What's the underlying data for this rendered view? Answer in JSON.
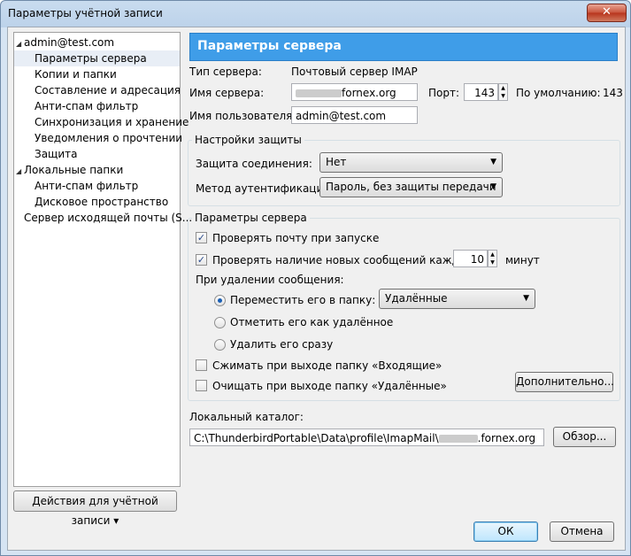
{
  "window": {
    "title": "Параметры учётной записи",
    "close_label": "✕"
  },
  "tree": {
    "items": [
      {
        "label": "admin@test.com",
        "expander": "◢"
      },
      {
        "label": "Параметры сервера"
      },
      {
        "label": "Копии и папки"
      },
      {
        "label": "Составление и адресация"
      },
      {
        "label": "Анти-спам фильтр"
      },
      {
        "label": "Синхронизация и хранение"
      },
      {
        "label": "Уведомления о прочтении"
      },
      {
        "label": "Защита"
      },
      {
        "label": "Локальные папки",
        "expander": "◢"
      },
      {
        "label": "Анти-спам фильтр"
      },
      {
        "label": "Дисковое пространство"
      },
      {
        "label": "Сервер исходящей почты (S..."
      }
    ],
    "actions_label": "Действия для учётной записи",
    "actions_arrow": "▾"
  },
  "banner": {
    "title": "Параметры сервера"
  },
  "server": {
    "type_label": "Тип сервера:",
    "type_value": "Почтовый сервер IMAP",
    "name_label": "Имя сервера:",
    "name_value": "fornex.org",
    "port_label": "Порт:",
    "port_value": "143",
    "default_label": "По умолчанию:",
    "default_value": "143",
    "user_label": "Имя пользователя:",
    "user_value": "admin@test.com"
  },
  "security": {
    "group_label": "Настройки защиты",
    "connection_label": "Защита соединения:",
    "connection_value": "Нет",
    "auth_label": "Метод аутентификации:",
    "auth_value": "Пароль, без защиты передачи"
  },
  "settings": {
    "group_label": "Параметры сервера",
    "check_startup": "Проверять почту при запуске",
    "check_every": "Проверять наличие новых сообщений каждые",
    "interval_value": "10",
    "minutes": "минут",
    "on_delete": "При удалении сообщения:",
    "move_to_folder": "Переместить его в папку:",
    "folder_value": "Удалённые",
    "mark_deleted": "Отметить его как удалённое",
    "delete_now": "Удалить его сразу",
    "compact_inbox": "Сжимать при выходе папку «Входящие»",
    "clean_trash": "Очищать при выходе папку «Удалённые»",
    "advanced_button": "Дополнительно..."
  },
  "local": {
    "label": "Локальный каталог:",
    "path_prefix": "C:\\ThunderbirdPortable\\Data\\profile\\ImapMail\\",
    "path_suffix": ".fornex.org",
    "browse_button": "Обзор..."
  },
  "footer": {
    "ok": "ОК",
    "cancel": "Отмена"
  },
  "icons": {
    "check": "✓",
    "combo_arrow": "▼",
    "spin_up": "▲",
    "spin_down": "▼"
  }
}
